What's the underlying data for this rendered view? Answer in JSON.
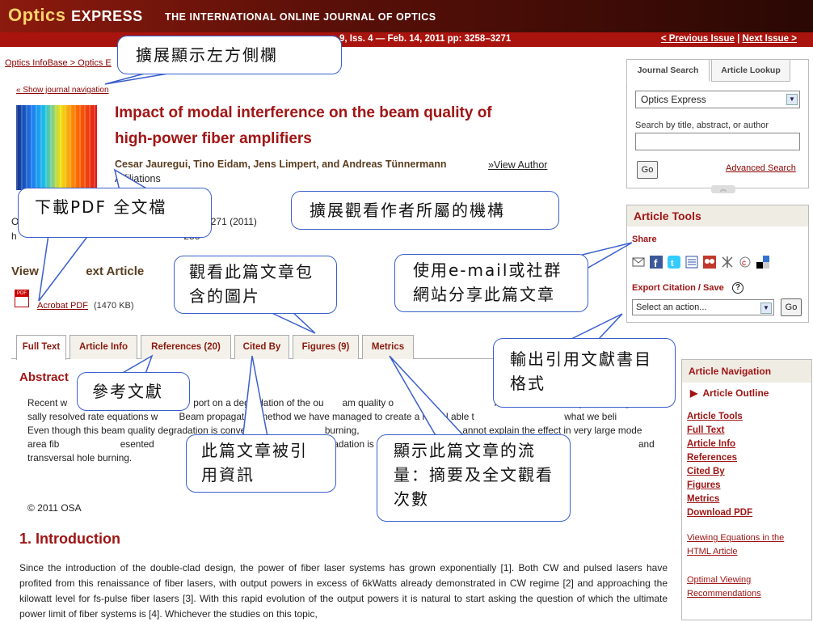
{
  "header": {
    "brand_optics": "Optics",
    "brand_express": "EXPRESS",
    "tagline": "THE INTERNATIONAL ONLINE JOURNAL OF OPTICS",
    "volume": "9, Iss. 4 — Feb. 14, 2011 pp: 3258–3271",
    "prev_issue": "< Previous Issue",
    "separator": "|",
    "next_issue": "Next Issue >"
  },
  "breadcrumb": "Optics InfoBase > Optics E",
  "show_nav": "« Show journal navigation",
  "article": {
    "title_line1": "Impact of modal interference on the beam quality of",
    "title_line2": "high-power fiber amplifiers",
    "authors": "Cesar Jauregui, Tino Eidam, Jens Limpert, and Andreas Tünnermann",
    "view_author": "»View Author",
    "affiliations": "Affiliations",
    "citation_line1": "O                                                              258-3271 (2011)",
    "citation_line2": "h                                                              258",
    "view_full": "View              ext Article",
    "pdf_link": "Acrobat PDF",
    "pdf_size": "(1470 KB)"
  },
  "tabs": [
    "Full Text",
    "Article Info",
    "References (20)",
    "Cited By",
    "Figures (9)",
    "Metrics"
  ],
  "abstract": {
    "heading": "Abstract",
    "text": "Recent w                           amplifier       port on a degradation of the ou       am quality o                                      mode instabilities. By combining the tr          sally resolved rate equations w        Beam propagation method we have managed to create a model able t                                  what we beli                  Even though this beam quality degradation is conventio                        burning,                                       annot explain the effect in very large mode area fib                       esented                                 the beam quality degradation is an inversion-induc                   play be                                       and transversal hole burning.",
    "copyright": "© 2011 OSA"
  },
  "intro": {
    "heading": "1. Introduction",
    "text": "Since the introduction of the double-clad design, the power of fiber laser systems has grown exponentially [1]. Both CW and pulsed lasers have profited from this renaissance of fiber lasers, with output powers in excess of 6kWatts already demonstrated in CW regime [2] and approaching the kilowatt level for fs-pulse fiber lasers [3]. With this rapid evolution of the output powers it is natural to start asking the question of which the ultimate power limit of fiber systems is [4]. Whichever the studies on this topic,"
  },
  "search": {
    "tab_journal": "Journal Search",
    "tab_lookup": "Article Lookup",
    "journal": "Optics Express",
    "label": "Search by title, abstract, or author",
    "go": "Go",
    "advanced": "Advanced Search"
  },
  "tools": {
    "heading": "Article Tools",
    "share": "Share",
    "export": "Export Citation / Save",
    "help": "?",
    "action_placeholder": "Select an action...",
    "go": "Go",
    "icons": [
      "email-icon",
      "facebook-icon",
      "twitter-icon",
      "list-icon",
      "social-icon",
      "share-icon",
      "citeulike-icon",
      "delicious-icon"
    ]
  },
  "nav": {
    "heading": "Article Navigation",
    "outline": "Article Outline",
    "links": [
      "Article Tools",
      "Full Text",
      "Article Info",
      "References",
      "Cited By",
      "Figures",
      "Metrics",
      "Download PDF"
    ],
    "note1": "Viewing Equations in the HTML Article",
    "note2": "Optimal Viewing Recommendations"
  },
  "callouts": {
    "sidebar": "擴展顯示左方側欄",
    "pdf": "下載PDF 全文檔",
    "affil": "擴展觀看作者所屬的機構",
    "figures": "觀看此篇文章包含的圖片",
    "share": "使用e-mail或社群網站分享此篇文章",
    "export": "輸出引用文獻書目格式",
    "refs": "參考文獻",
    "cited": "此篇文章被引用資訊",
    "metrics": "顯示此篇文章的流量：摘要及全文觀看次數"
  }
}
